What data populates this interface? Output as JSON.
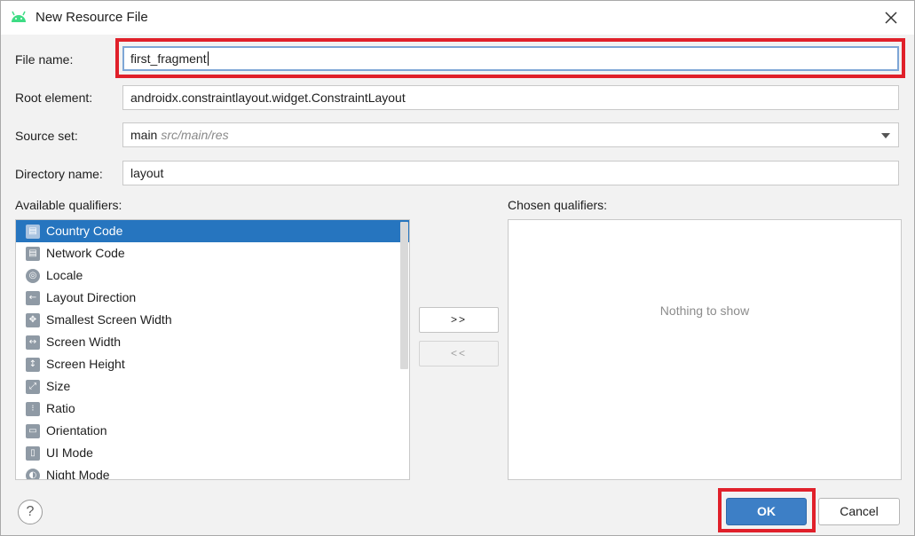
{
  "dialog": {
    "title": "New Resource File"
  },
  "form": {
    "file_name_label": "File name:",
    "file_name_value": "first_fragment",
    "root_element_label": "Root element:",
    "root_element_value": "androidx.constraintlayout.widget.ConstraintLayout",
    "source_set_label": "Source set:",
    "source_set_value": "main",
    "source_set_hint": "src/main/res",
    "directory_name_label": "Directory name:",
    "directory_name_value": "layout"
  },
  "qualifiers": {
    "available_label": "Available qualifiers:",
    "chosen_label": "Chosen qualifiers:",
    "chosen_empty_text": "Nothing to show",
    "add_button": ">>",
    "remove_button": "<<",
    "items": [
      {
        "label": "Country Code",
        "icon": "country-code-icon",
        "selected": true
      },
      {
        "label": "Network Code",
        "icon": "network-code-icon",
        "selected": false
      },
      {
        "label": "Locale",
        "icon": "globe-icon",
        "selected": false
      },
      {
        "label": "Layout Direction",
        "icon": "layout-direction-icon",
        "selected": false
      },
      {
        "label": "Smallest Screen Width",
        "icon": "smallest-screen-width-icon",
        "selected": false
      },
      {
        "label": "Screen Width",
        "icon": "screen-width-icon",
        "selected": false
      },
      {
        "label": "Screen Height",
        "icon": "screen-height-icon",
        "selected": false
      },
      {
        "label": "Size",
        "icon": "size-icon",
        "selected": false
      },
      {
        "label": "Ratio",
        "icon": "ratio-icon",
        "selected": false
      },
      {
        "label": "Orientation",
        "icon": "orientation-icon",
        "selected": false
      },
      {
        "label": "UI Mode",
        "icon": "ui-mode-icon",
        "selected": false
      },
      {
        "label": "Night Mode",
        "icon": "night-mode-icon",
        "selected": false
      }
    ]
  },
  "footer": {
    "help": "?",
    "ok": "OK",
    "cancel": "Cancel"
  },
  "colors": {
    "selection": "#2675bf",
    "ok_button": "#3d7fc6",
    "highlight_box": "#e0202a",
    "android_green": "#3ddc84"
  }
}
